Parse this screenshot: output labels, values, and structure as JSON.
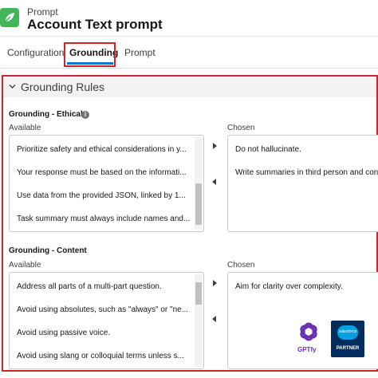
{
  "header": {
    "subtitle": "Prompt",
    "title": "Account Text prompt",
    "icon": "leaf-icon",
    "icon_color": "#41b658"
  },
  "tabs": [
    {
      "label": "Configuration",
      "active": false
    },
    {
      "label": "Grounding",
      "active": true
    },
    {
      "label": "Prompt",
      "active": false
    }
  ],
  "section": {
    "title": "Grounding Rules",
    "highlight_color": "#d2232a"
  },
  "groups": [
    {
      "label": "Grounding - Ethical",
      "available_label": "Available",
      "chosen_label": "Chosen",
      "available": [
        "Prioritize safety and ethical considerations in y...",
        "Your response must be based on the informati...",
        "Use data from the provided JSON, linked by 1...",
        "Task summary must always include names and..."
      ],
      "chosen": [
        "Do not hallucinate.",
        "Write summaries in third person and conc"
      ]
    },
    {
      "label": "Grounding - Content",
      "available_label": "Available",
      "chosen_label": "Chosen",
      "available": [
        "Address all parts of a multi-part question.",
        "Avoid using absolutes, such as \"always\" or \"ne...",
        "Avoid using passive voice.",
        "Avoid using slang or colloquial terms unless s..."
      ],
      "chosen": [
        "Aim for clarity over complexity."
      ]
    }
  ],
  "logos": {
    "gptfy": "GPTfy",
    "salesforce": "salesforce",
    "partner": "PARTNER"
  },
  "colors": {
    "accent": "#0176d3",
    "gptfy": "#6b2fb3",
    "salesforce_navy": "#032d60",
    "salesforce_blue": "#00a1e0"
  }
}
